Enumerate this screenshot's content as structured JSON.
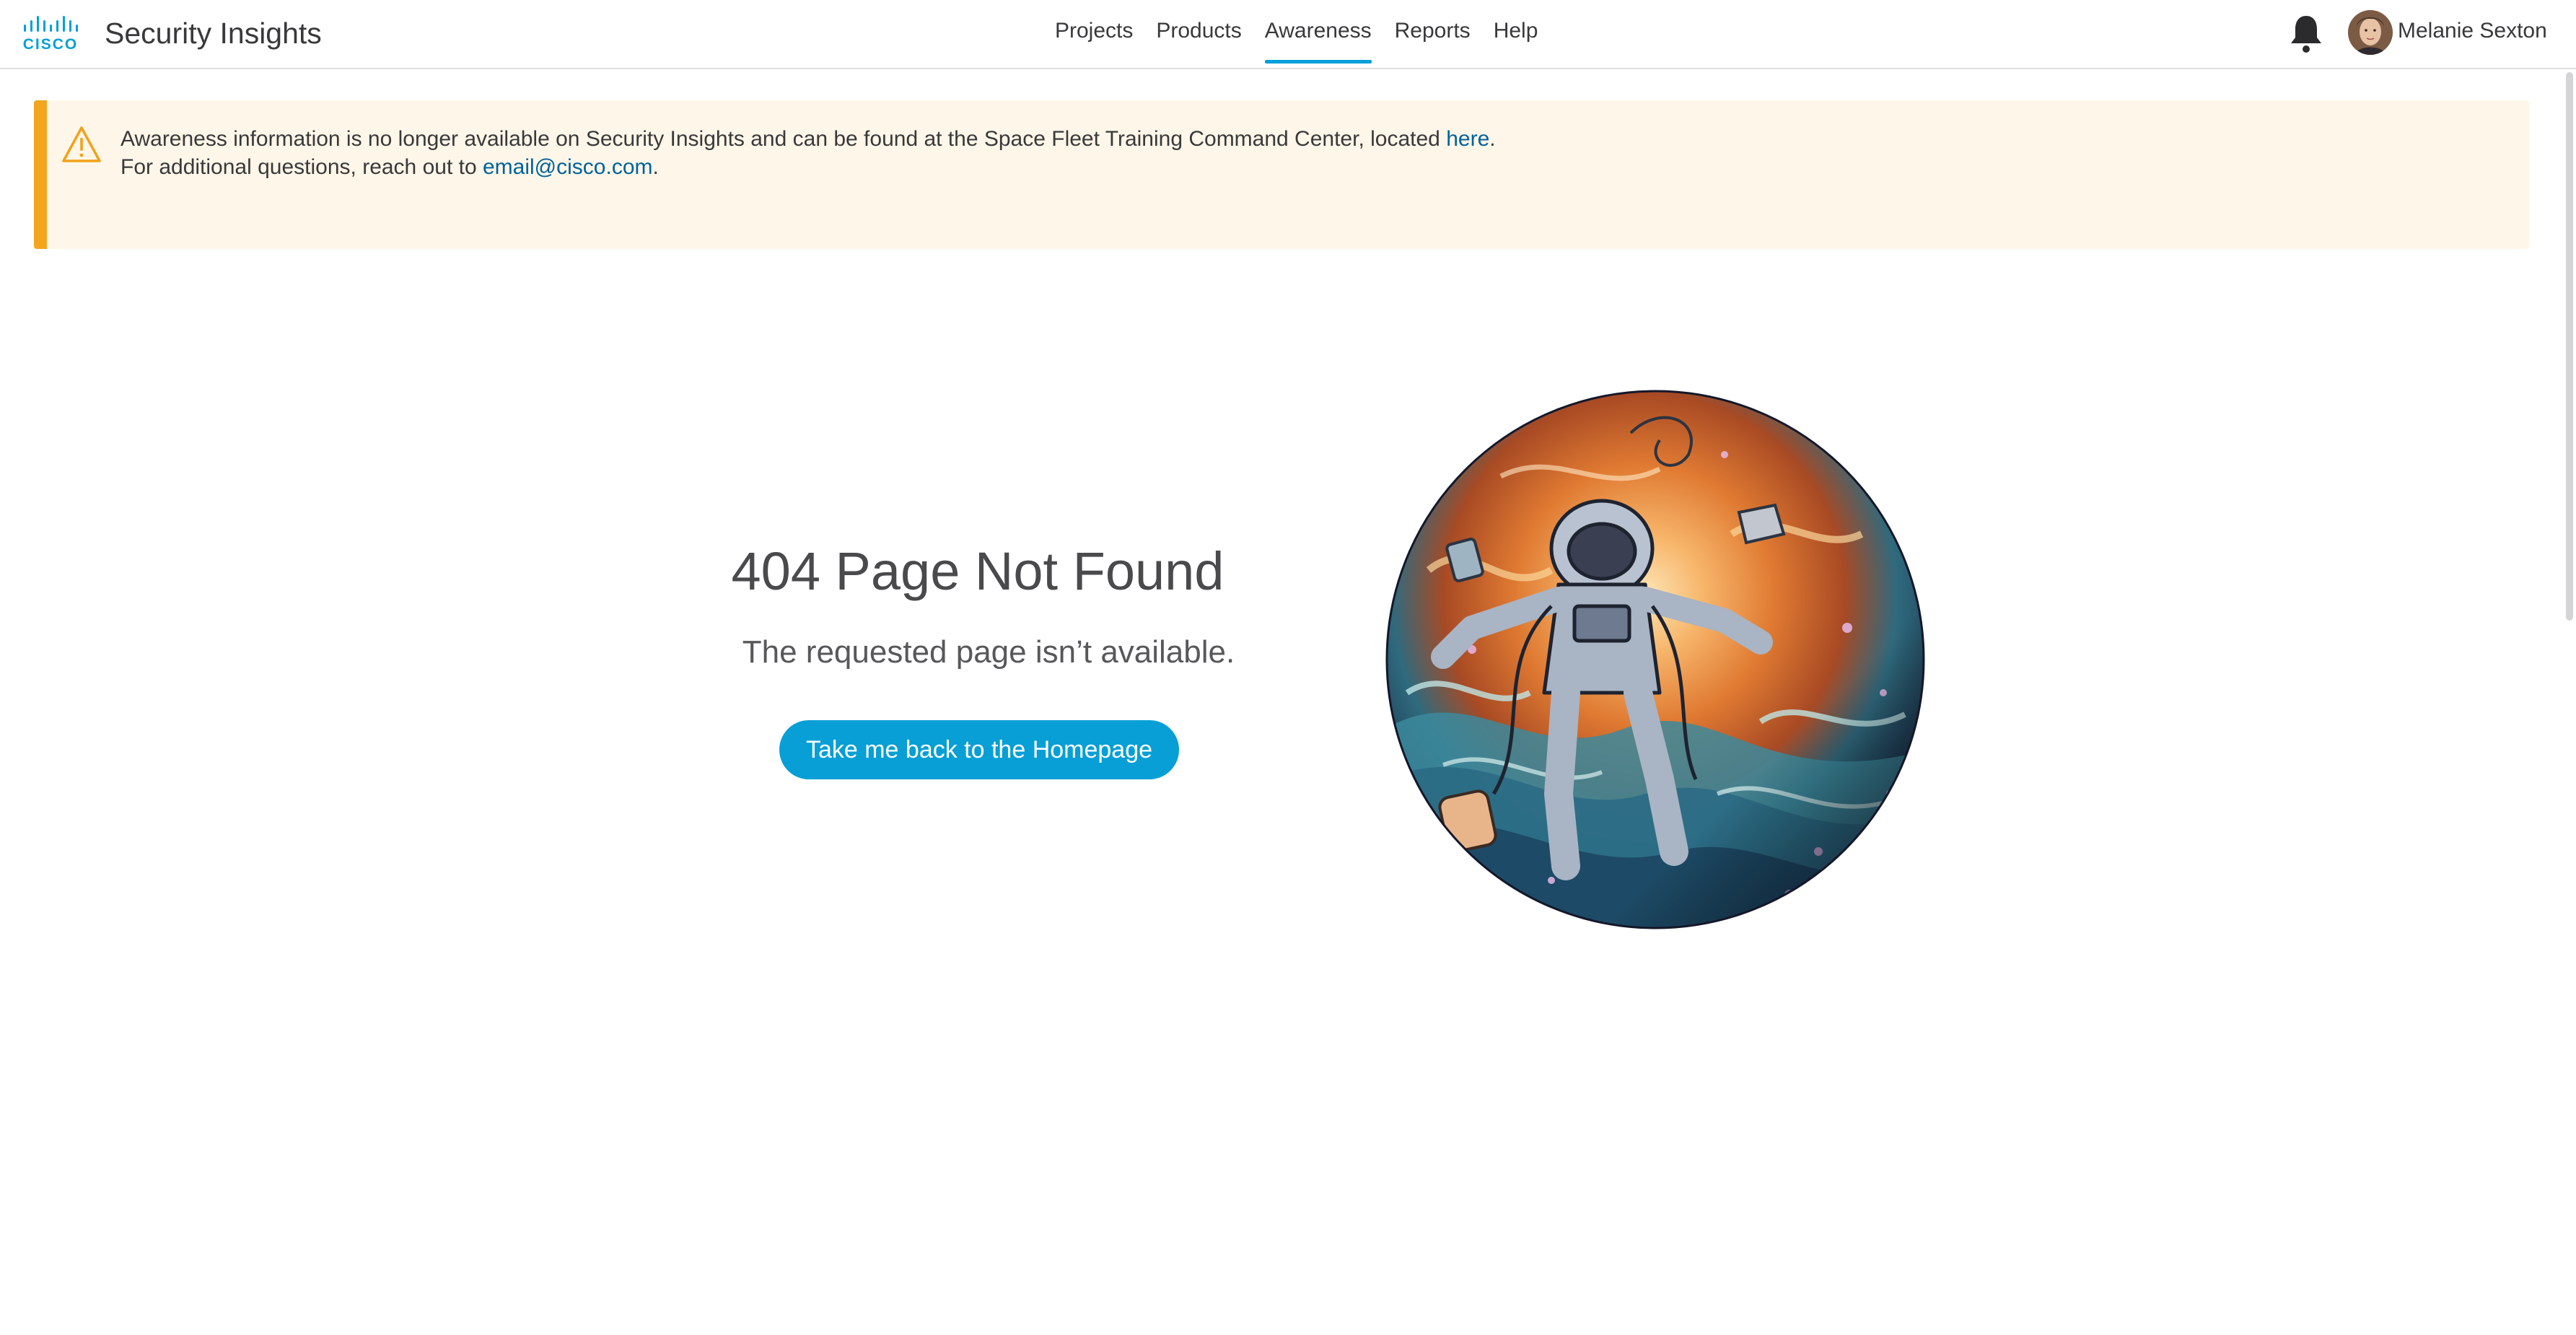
{
  "app": {
    "title": "Security Insights",
    "logo_text": "CISCO",
    "logo_icon": "cisco-logo"
  },
  "nav": {
    "items": [
      {
        "label": "Projects",
        "active": false
      },
      {
        "label": "Products",
        "active": false
      },
      {
        "label": "Awareness",
        "active": true
      },
      {
        "label": "Reports",
        "active": false
      },
      {
        "label": "Help",
        "active": false
      }
    ]
  },
  "user": {
    "name": "Melanie Sexton",
    "notification_icon": "bell-icon"
  },
  "alert": {
    "icon": "warning-triangle-icon",
    "line1_prefix": "Awareness information is no longer available on Security Insights and can be found at the Space Fleet Training Command Center, located ",
    "line1_link": "here",
    "line1_suffix": ".",
    "line2_prefix": "For additional questions, reach out to ",
    "line2_link": "email@cisco.com",
    "line2_suffix": ".",
    "accent_color": "#f3a51e",
    "background_color": "#fef6e8"
  },
  "error": {
    "title": "404 Page Not Found",
    "subtitle": "The requested page isn’t available.",
    "button_label": "Take me back to the Homepage",
    "illustration": "astronaut-in-space-illustration"
  },
  "colors": {
    "brand": "#049fd9",
    "button": "#079fd6",
    "link": "#00629b"
  }
}
